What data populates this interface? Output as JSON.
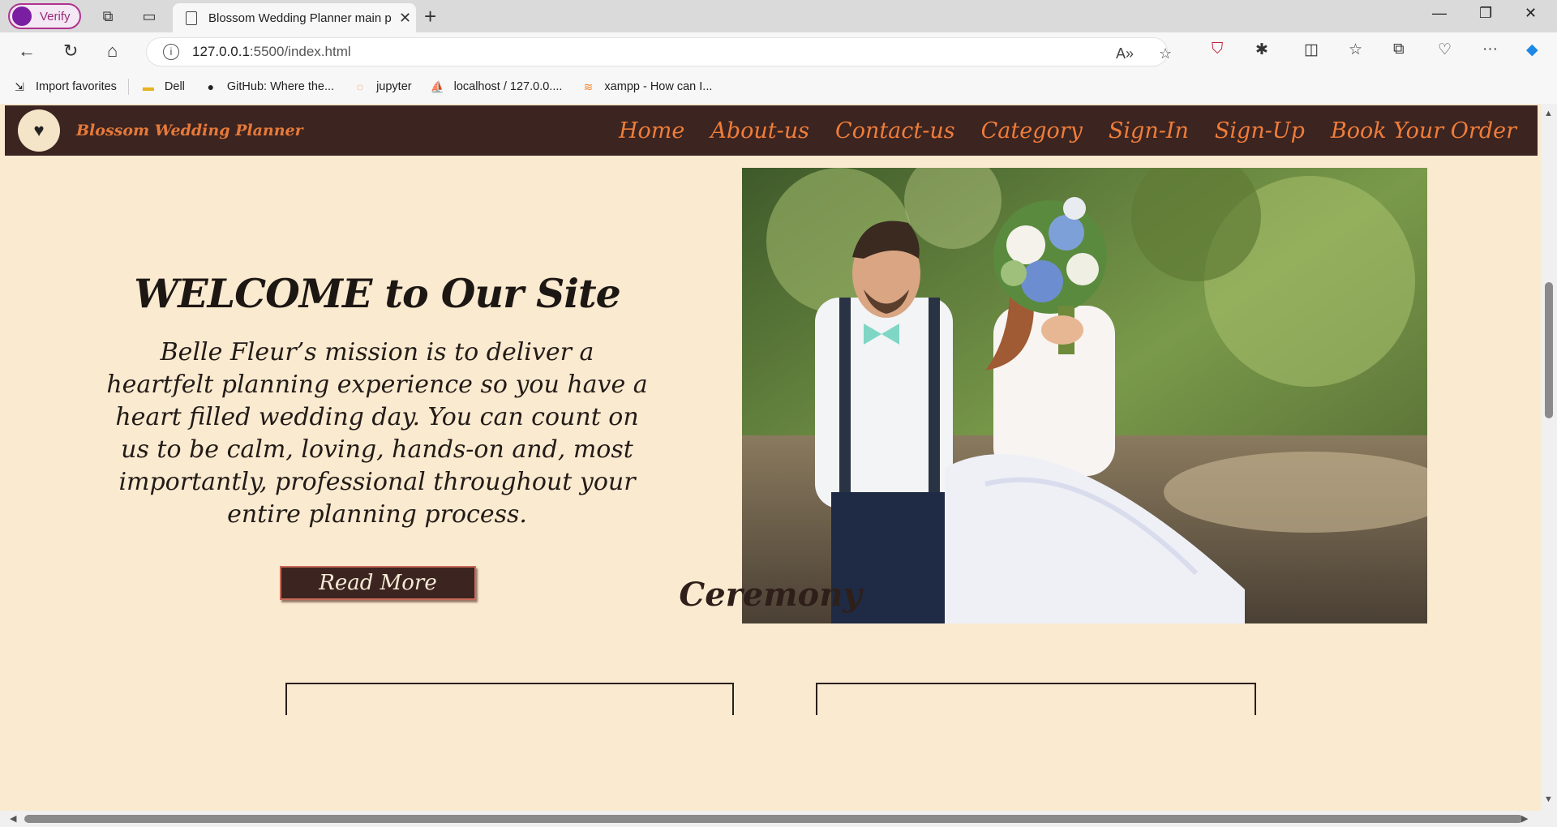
{
  "browser": {
    "profile_label": "Verify",
    "tab_title": "Blossom Wedding Planner main page",
    "url_host": "127.0.0.1",
    "url_rest": ":5500/index.html",
    "bookmarks": [
      {
        "label": "Import favorites",
        "icon": "import-icon"
      },
      {
        "label": "Dell",
        "icon": "folder-icon"
      },
      {
        "label": "GitHub: Where the...",
        "icon": "github-icon"
      },
      {
        "label": "jupyter",
        "icon": "jupyter-icon"
      },
      {
        "label": "localhost / 127.0.0....",
        "icon": "phpmyadmin-icon"
      },
      {
        "label": "xampp - How can I...",
        "icon": "stackoverflow-icon"
      }
    ]
  },
  "site": {
    "brand": "Blossom Wedding Planner",
    "nav": [
      "Home",
      "About-us",
      "Contact-us",
      "Category",
      "Sign-In",
      "Sign-Up",
      "Book Your Order"
    ],
    "hero": {
      "title": "WELCOME to Our Site",
      "body": "Belle Fleur’s mission is to deliver a heartfelt planning experience so you have a heart filled wedding day. You can count on us to be calm, loving, hands-on and, most importantly, professional throughout your entire planning process.",
      "button": "Read More"
    },
    "section_title": "Ceremony"
  },
  "colors": {
    "page_bg": "#faead0",
    "nav_bg": "#3c2420",
    "nav_text": "#ef7d3a",
    "button_bg": "#3c2420"
  }
}
